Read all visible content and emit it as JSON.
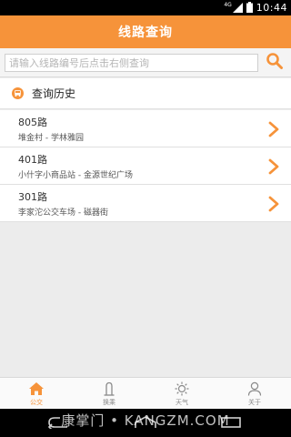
{
  "status_bar": {
    "network": "4G",
    "time": "10:44"
  },
  "header": {
    "title": "线路查询"
  },
  "search": {
    "placeholder": "请输入线路编号后点击右侧查询",
    "value": ""
  },
  "history": {
    "title": "查询历史",
    "items": [
      {
        "route": "805路",
        "stops": "堆金村 - 学林雅园"
      },
      {
        "route": "401路",
        "stops": "小什字小商品站 - 金源世纪广场"
      },
      {
        "route": "301路",
        "stops": "李家沱公交车场 - 磁器街"
      }
    ]
  },
  "tabs": [
    {
      "label": "公交",
      "icon": "home-icon",
      "active": true
    },
    {
      "label": "换乘",
      "icon": "transfer-icon",
      "active": false
    },
    {
      "label": "天气",
      "icon": "weather-sun-icon",
      "active": false
    },
    {
      "label": "关于",
      "icon": "user-icon",
      "active": false
    }
  ],
  "watermark": "康掌门 • KANGZM.COM",
  "colors": {
    "accent": "#f6933a",
    "background": "#ececec"
  }
}
